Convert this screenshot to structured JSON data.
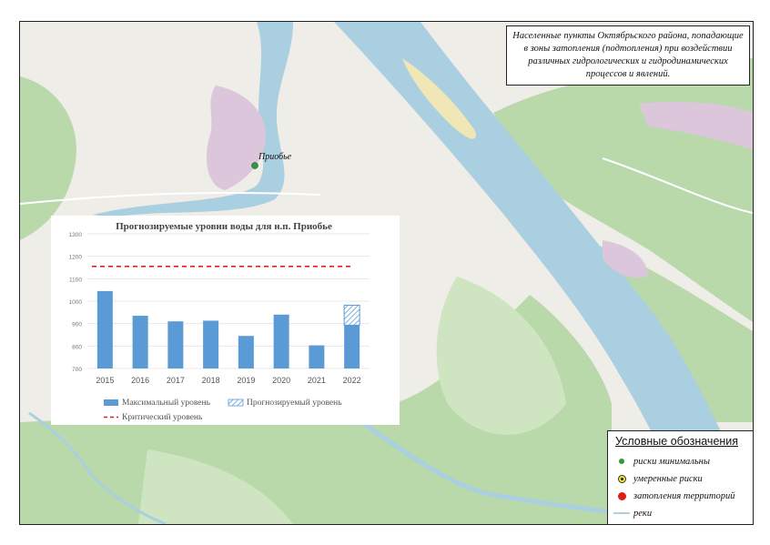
{
  "map": {
    "title": "Населенные пункты Октябрьского района, попадающие в зоны затопления (подтопления) при воздействии различных гидрологических и гидродинамических процессов и явлений.",
    "town_label": "Приобье",
    "colors": {
      "water": "#aacfe0",
      "forest": "#b9d9ab",
      "land": "#efede7",
      "settlement": "#dcc6dc",
      "sand": "#f1e6b6"
    }
  },
  "legend": {
    "title": "Условные обозначения",
    "items": [
      {
        "label": "риски минимальны",
        "icon": "green-dot-icon",
        "color": "#2e9a3a"
      },
      {
        "label": "умеренные риски",
        "icon": "yellow-dot-icon",
        "color": "#f5e52c"
      },
      {
        "label": "затопления территорий",
        "icon": "red-dot-icon",
        "color": "#e01b1b"
      },
      {
        "label": "реки",
        "icon": "river-line-icon",
        "color": "#a9d0e4"
      }
    ]
  },
  "chart_data": {
    "type": "bar",
    "title": "Прогнозируемые уровни воды для н.п. Приобье",
    "categories": [
      "2015",
      "2016",
      "2017",
      "2018",
      "2019",
      "2020",
      "2021",
      "2022"
    ],
    "series": [
      {
        "name": "Максимальный уровень",
        "values": [
          1045,
          935,
          910,
          913,
          845,
          940,
          803,
          893
        ],
        "color": "#5b9bd5"
      },
      {
        "name": "Прогнозируемый уровень",
        "values": [
          null,
          null,
          null,
          null,
          null,
          null,
          null,
          982
        ],
        "pattern": "hatched",
        "color": "#5b9bd5"
      },
      {
        "name": "Критический уровень",
        "values": [
          1155,
          1155,
          1155,
          1155,
          1155,
          1155,
          1155,
          1155
        ],
        "style": "dashed-line",
        "color": "#e02020"
      }
    ],
    "ylim": [
      700,
      1300
    ],
    "yticks": [
      "700",
      "800",
      "900",
      "1000",
      "1100",
      "1200",
      "1300"
    ],
    "grid": true,
    "legend_position": "bottom"
  }
}
